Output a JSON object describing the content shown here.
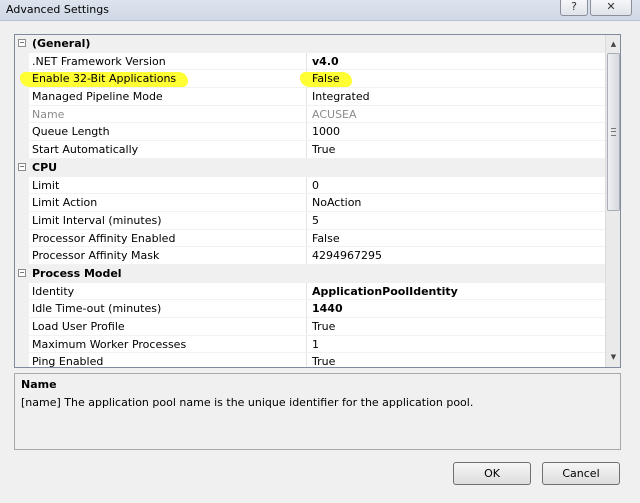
{
  "window": {
    "title": "Advanced Settings",
    "help_label": "?",
    "close_label": "✕"
  },
  "grid": {
    "categories": [
      {
        "name": "(General)",
        "toggle": "−",
        "properties": [
          {
            "name": ".NET Framework Version",
            "value": "v4.0",
            "bold": true
          },
          {
            "name": "Enable 32-Bit Applications",
            "value": "False",
            "highlighted": true
          },
          {
            "name": "Managed Pipeline Mode",
            "value": "Integrated"
          },
          {
            "name": "Name",
            "value": "ACUSEA",
            "disabled": true
          },
          {
            "name": "Queue Length",
            "value": "1000"
          },
          {
            "name": "Start Automatically",
            "value": "True"
          }
        ]
      },
      {
        "name": "CPU",
        "toggle": "−",
        "properties": [
          {
            "name": "Limit",
            "value": "0"
          },
          {
            "name": "Limit Action",
            "value": "NoAction"
          },
          {
            "name": "Limit Interval (minutes)",
            "value": "5"
          },
          {
            "name": "Processor Affinity Enabled",
            "value": "False"
          },
          {
            "name": "Processor Affinity Mask",
            "value": "4294967295"
          }
        ]
      },
      {
        "name": "Process Model",
        "toggle": "−",
        "properties": [
          {
            "name": "Identity",
            "value": "ApplicationPoolIdentity",
            "bold": true
          },
          {
            "name": "Idle Time-out (minutes)",
            "value": "1440",
            "bold": true
          },
          {
            "name": "Load User Profile",
            "value": "True"
          },
          {
            "name": "Maximum Worker Processes",
            "value": "1"
          },
          {
            "name": "Ping Enabled",
            "value": "True"
          }
        ]
      }
    ],
    "scroll_up_icon": "▲",
    "scroll_down_icon": "▼"
  },
  "description": {
    "title": "Name",
    "text": "[name] The application pool name is the unique identifier for the application pool."
  },
  "buttons": {
    "ok": "OK",
    "cancel": "Cancel"
  },
  "colors": {
    "highlight": "#ffff33",
    "grid_border": "#7f8c9d",
    "disabled_text": "#8c8c8c"
  }
}
